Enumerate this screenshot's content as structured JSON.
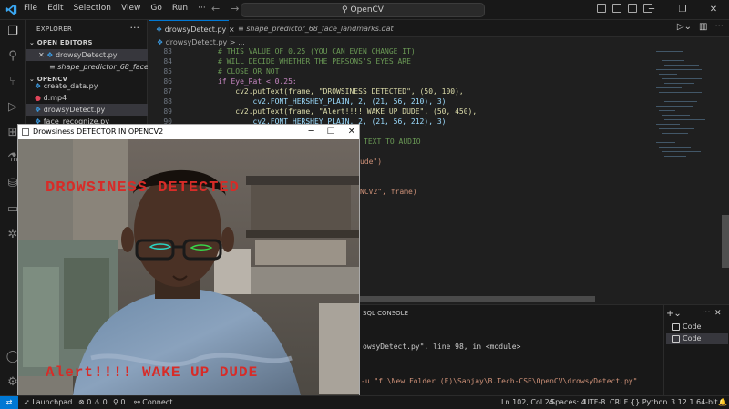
{
  "menu": {
    "items": [
      "File",
      "Edit",
      "Selection",
      "View",
      "Go",
      "Run",
      "···"
    ]
  },
  "search": {
    "text": "OpenCV"
  },
  "explorer": {
    "title": "EXPLORER",
    "open_editors_title": "OPEN EDITORS",
    "open_editors": [
      "drowsyDetect.py",
      "shape_predictor_68_face_la..."
    ],
    "folder_title": "OPENCV",
    "files": [
      "create_data.py",
      "d.mp4",
      "drowsyDetect.py",
      "face_recognize.py"
    ]
  },
  "tabs": [
    {
      "label": "drowsyDetect.py",
      "close": "×"
    },
    {
      "label": "shape_predictor_68_face_landmarks.dat",
      "close": ""
    }
  ],
  "breadcrumb": {
    "text": "drowsyDetect.py > ..."
  },
  "code": {
    "lines": [
      {
        "n": "83",
        "t": "# THIS VALUE OF 0.25 (YOU CAN EVEN CHANGE IT)",
        "c": "c-com"
      },
      {
        "n": "84",
        "t": "# WILL DECIDE WHETHER THE PERSONS'S EYES ARE",
        "c": "c-com"
      },
      {
        "n": "85",
        "t": "# CLOSE OR NOT",
        "c": "c-com"
      },
      {
        "n": "86",
        "t": "if Eye_Rat < 0.25:",
        "c": "c-kw"
      },
      {
        "n": "87",
        "t": "    cv2.putText(frame, \"DROWSINESS DETECTED\", (50, 100),",
        "c": "c-def"
      },
      {
        "n": "88",
        "t": "        cv2.FONT_HERSHEY_PLAIN, 2, (21, 56, 210), 3)",
        "c": "c-var"
      },
      {
        "n": "89",
        "t": "    cv2.putText(frame, \"Alert!!!! WAKE UP DUDE\", (50, 450),",
        "c": "c-def"
      },
      {
        "n": "90",
        "t": "        cv2.FONT_HERSHEY_PLAIN, 2, (21, 56, 212), 3)",
        "c": "c-var"
      }
    ],
    "behind": [
      {
        "t": "TEXT TO AUDIO",
        "c": "c-com"
      },
      {
        "t": "ude\")",
        "c": "c-str"
      },
      {
        "t": "NCV2\", frame)",
        "c": "c-str"
      }
    ]
  },
  "panel": {
    "tab": "SQL CONSOLE",
    "trace": "owsyDetect.py\", line 98, in <module>",
    "cmd": "-u \"f:\\New Folder (F)\\Sanjay\\B.Tech-CSE\\OpenCV\\drowsyDetect.py\"",
    "terminals": [
      "Code",
      "Code"
    ]
  },
  "status": {
    "launchpad": "Launchpad",
    "problems": "⊗ 0 ⚠ 0",
    "ports": "⚲ 0",
    "connect": "Connect",
    "position": "Ln 102, Col 24",
    "spaces": "Spaces: 4",
    "encoding": "UTF-8",
    "eol": "CRLF",
    "language": "Python",
    "interpreter": "3.12.1 64-bit"
  },
  "cv_window": {
    "title": "Drowsiness DETECTOR IN OPENCV2",
    "overlay_top": "DROWSINESS DETECTED",
    "overlay_bottom": "Alert!!!! WAKE UP DUDE"
  }
}
